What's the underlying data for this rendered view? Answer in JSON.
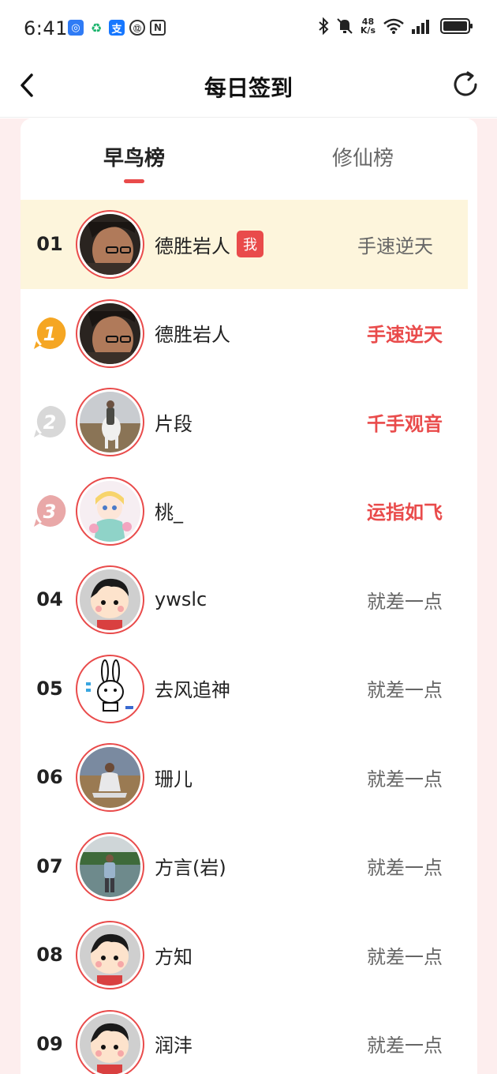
{
  "status_bar": {
    "time": "6:41",
    "net_speed_value": "48",
    "net_speed_unit": "K/s",
    "app_icons": [
      "blue-app-icon",
      "green-app-icon",
      "alipay-icon",
      "circle-app-icon",
      "nfc-icon"
    ],
    "right_icons": [
      "bluetooth-icon",
      "mute-icon",
      "wifi-icon",
      "signal-icon",
      "battery-icon"
    ]
  },
  "header": {
    "title": "每日签到",
    "back_icon": "chevron-left-icon",
    "refresh_icon": "refresh-icon"
  },
  "tabs": [
    {
      "label": "早鸟榜",
      "active": true
    },
    {
      "label": "修仙榜",
      "active": false
    }
  ],
  "me_badge": "我",
  "rows": [
    {
      "rank": "01",
      "name": "德胜岩人",
      "status": "手速逆天",
      "is_me": true,
      "avatar": "photo-man-glasses"
    },
    {
      "rank": "1",
      "name": "德胜岩人",
      "status": "手速逆天",
      "medal": "gold",
      "avatar": "photo-man-glasses"
    },
    {
      "rank": "2",
      "name": "片段",
      "status": "千手观音",
      "medal": "silver",
      "avatar": "photo-horse-rider"
    },
    {
      "rank": "3",
      "name": "桃_",
      "status": "运指如飞",
      "medal": "bronze",
      "avatar": "anime-girl"
    },
    {
      "rank": "04",
      "name": "ywslc",
      "status": "就差一点",
      "avatar": "cartoon-boy"
    },
    {
      "rank": "05",
      "name": "去风追神",
      "status": "就差一点",
      "avatar": "cartoon-rabbit"
    },
    {
      "rank": "06",
      "name": "珊儿",
      "status": "就差一点",
      "avatar": "photo-woman-sitting"
    },
    {
      "rank": "07",
      "name": "方言(岩)",
      "status": "就差一点",
      "avatar": "photo-man-lake"
    },
    {
      "rank": "08",
      "name": "方知",
      "status": "就差一点",
      "avatar": "cartoon-boy"
    },
    {
      "rank": "09",
      "name": "润沣",
      "status": "就差一点",
      "avatar": "cartoon-boy"
    }
  ],
  "colors": {
    "accent": "#e94b4b",
    "me_row_bg": "#fdf5dc",
    "page_bg": "#fdeeee",
    "gold": "#f5a623",
    "silver": "#d8d8d8",
    "bronze": "#e9a8a8"
  }
}
